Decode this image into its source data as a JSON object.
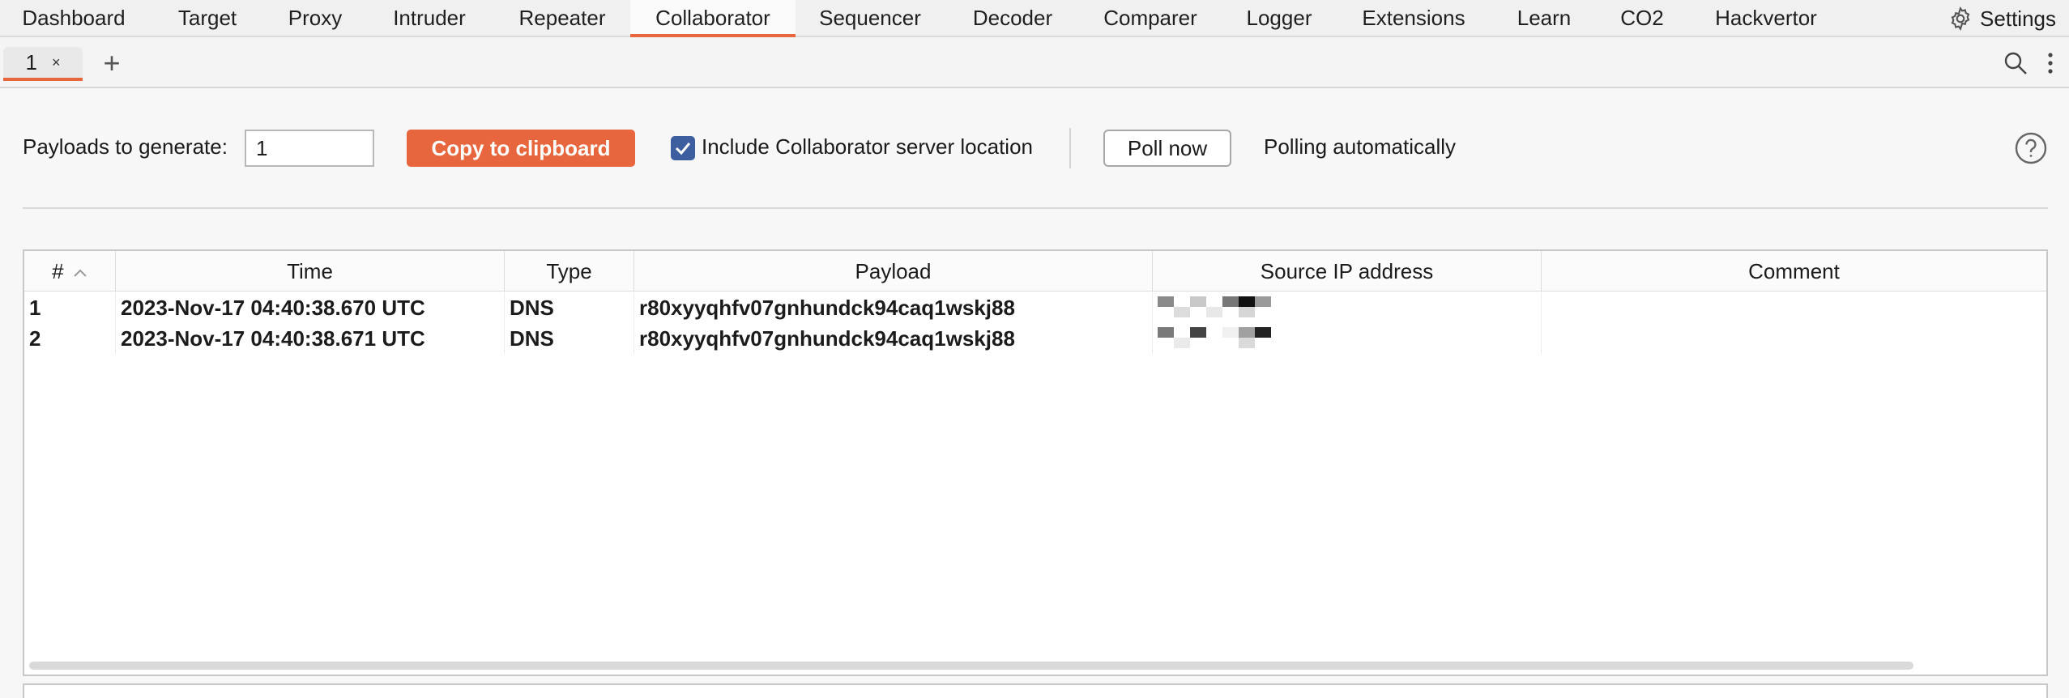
{
  "tool_tabs": [
    {
      "label": "Dashboard"
    },
    {
      "label": "Target"
    },
    {
      "label": "Proxy"
    },
    {
      "label": "Intruder"
    },
    {
      "label": "Repeater"
    },
    {
      "label": "Collaborator",
      "active": true
    },
    {
      "label": "Sequencer"
    },
    {
      "label": "Decoder"
    },
    {
      "label": "Comparer"
    },
    {
      "label": "Logger"
    },
    {
      "label": "Extensions"
    },
    {
      "label": "Learn"
    },
    {
      "label": "CO2"
    },
    {
      "label": "Hackvertor"
    }
  ],
  "settings": {
    "label": "Settings",
    "icon": "gear-icon"
  },
  "sub_tabs": [
    {
      "label": "1",
      "close": "×"
    }
  ],
  "add_tab": "+",
  "controls": {
    "payloads_label": "Payloads to generate:",
    "payloads_value": "1",
    "copy_label": "Copy to clipboard",
    "include_label": "Include Collaborator server location",
    "include_checked": true,
    "poll_label": "Poll now",
    "polling_status": "Polling automatically"
  },
  "table": {
    "columns": [
      "#",
      "Time",
      "Type",
      "Payload",
      "Source IP address",
      "Comment"
    ],
    "sort_column": "#",
    "sort_direction": "ascending",
    "rows": [
      {
        "n": "1",
        "time": "2023-Nov-17 04:40:38.670 UTC",
        "type": "DNS",
        "payload": "r80xyyqhfv07gnhundck94caq1wskj88",
        "ip": "",
        "comment": ""
      },
      {
        "n": "2",
        "time": "2023-Nov-17 04:40:38.671 UTC",
        "type": "DNS",
        "payload": "r80xyyqhfv07gnhundck94caq1wskj88",
        "ip": "",
        "comment": ""
      }
    ]
  },
  "colors": {
    "accent": "#e8663d",
    "checkbox": "#3d5fa0"
  }
}
